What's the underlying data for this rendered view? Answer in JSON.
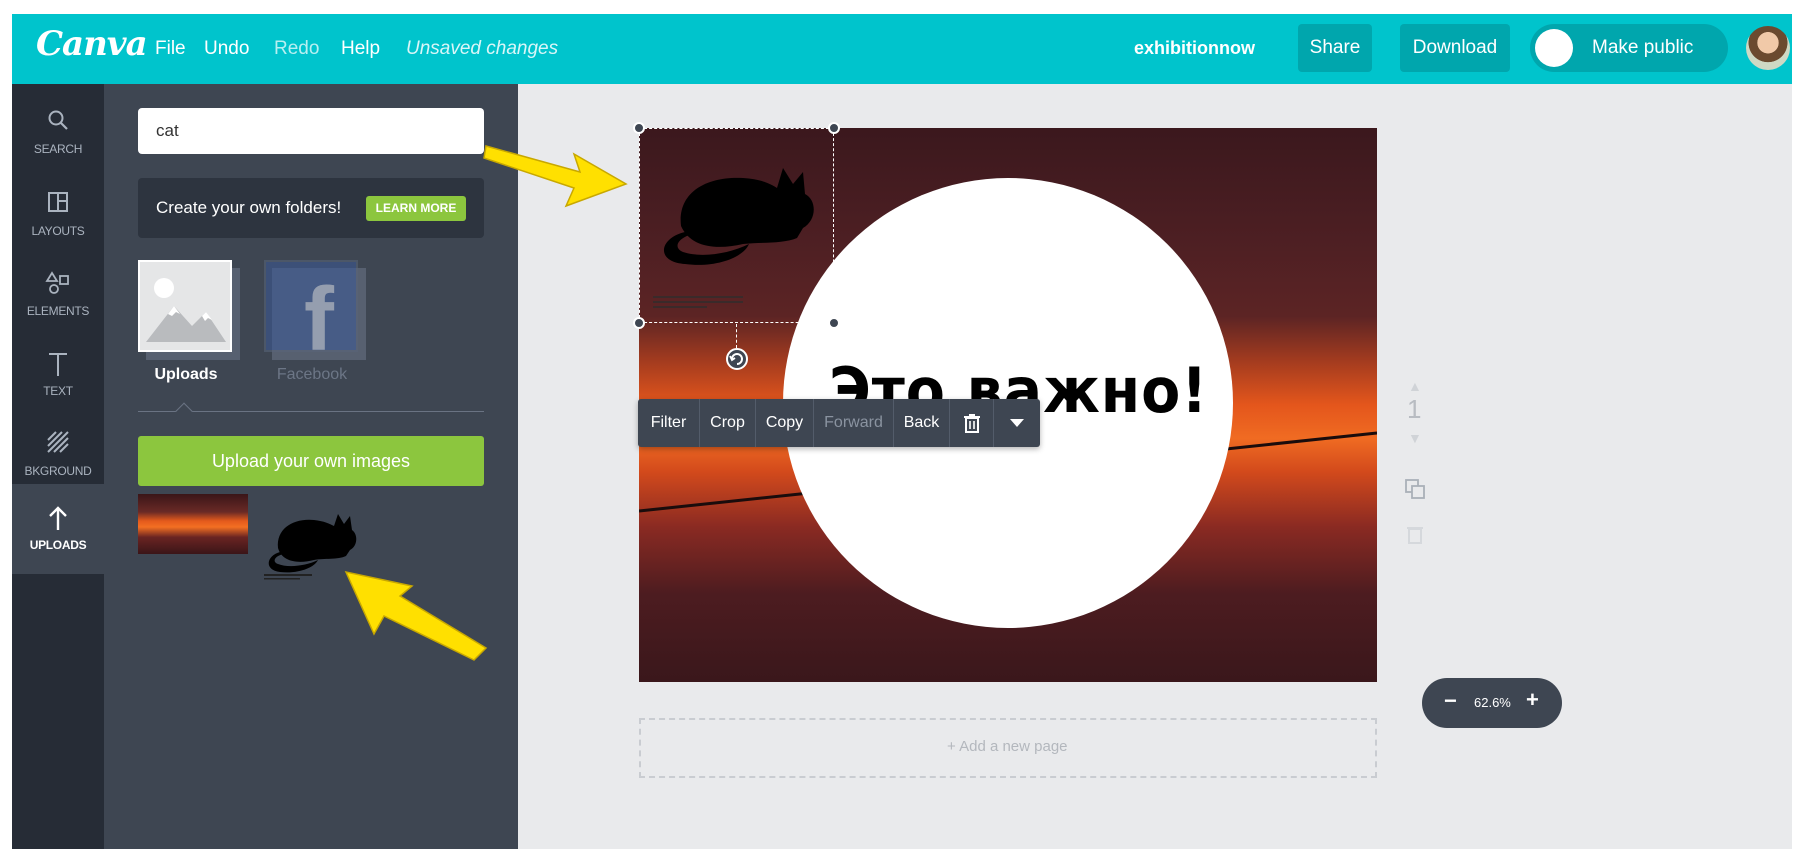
{
  "topbar": {
    "logo": "Canva",
    "menu": {
      "file": "File",
      "undo": "Undo",
      "redo": "Redo",
      "help": "Help"
    },
    "status": "Unsaved changes",
    "account": "exhibitionnow",
    "share": "Share",
    "download": "Download",
    "make_public": "Make public"
  },
  "leftnav": {
    "items": [
      {
        "label": "SEARCH",
        "icon": "search-icon"
      },
      {
        "label": "LAYOUTS",
        "icon": "layouts-icon"
      },
      {
        "label": "ELEMENTS",
        "icon": "elements-icon"
      },
      {
        "label": "TEXT",
        "icon": "text-icon"
      },
      {
        "label": "BKGROUND",
        "icon": "background-icon"
      },
      {
        "label": "UPLOADS",
        "icon": "upload-arrow-icon",
        "active": true
      }
    ]
  },
  "panel": {
    "search_value": "cat",
    "folders_text": "Create your own folders!",
    "learn_more": "LEARN MORE",
    "sources": [
      {
        "label": "Uploads"
      },
      {
        "label": "Facebook"
      }
    ],
    "upload_button": "Upload your own images"
  },
  "canvas": {
    "heading": "Это важно!",
    "toolbar": {
      "filter": "Filter",
      "crop": "Crop",
      "copy": "Copy",
      "forward": "Forward",
      "back": "Back"
    },
    "page_number": "1",
    "add_page": "+ Add a new page",
    "zoom": "62.6%"
  },
  "colors": {
    "topbar": "#00c4cc",
    "accent_green": "#8cc63e",
    "panel": "#3e4652",
    "nav": "#262c36",
    "annotation_arrow": "#ffe000"
  }
}
